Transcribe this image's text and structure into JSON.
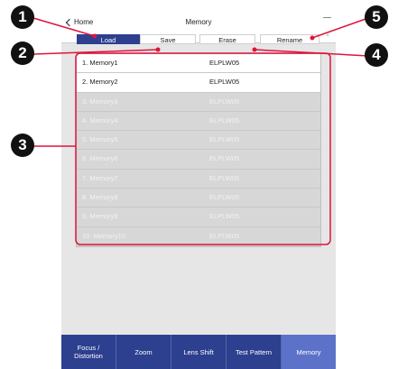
{
  "header": {
    "back_label": "Home",
    "title": "Memory"
  },
  "toolbar": {
    "load": "Load",
    "save": "Save",
    "erase": "Erase",
    "rename": "Rename"
  },
  "memories": [
    {
      "name": "1. Memory1",
      "model": "ELPLW05",
      "active": true
    },
    {
      "name": "2. Memory2",
      "model": "ELPLW05",
      "active": true
    },
    {
      "name": "3. Memory3",
      "model": "ELPLW05",
      "active": false
    },
    {
      "name": "4. Memory4",
      "model": "ELPLW05",
      "active": false
    },
    {
      "name": "5. Memory5",
      "model": "ELPLW05",
      "active": false
    },
    {
      "name": "6. Memory6",
      "model": "ELPLW05",
      "active": false
    },
    {
      "name": "7. Memory7",
      "model": "ELPLW05",
      "active": false
    },
    {
      "name": "8. Memory8",
      "model": "ELPLW05",
      "active": false
    },
    {
      "name": "9. Memory9",
      "model": "ELPLW05",
      "active": false
    },
    {
      "name": "10. Memory10",
      "model": "ELPLW05",
      "active": false
    }
  ],
  "tabs": [
    {
      "label": "Focus /\nDistortion",
      "selected": false
    },
    {
      "label": "Zoom",
      "selected": false
    },
    {
      "label": "Lens Shift",
      "selected": false
    },
    {
      "label": "Test Pattern",
      "selected": false
    },
    {
      "label": "Memory",
      "selected": true
    }
  ],
  "callouts": [
    "1",
    "2",
    "3",
    "4",
    "5"
  ],
  "colors": {
    "accent": "#2d3f8f",
    "selected_tab": "#5b72c8",
    "callout_line": "#e0143c"
  }
}
